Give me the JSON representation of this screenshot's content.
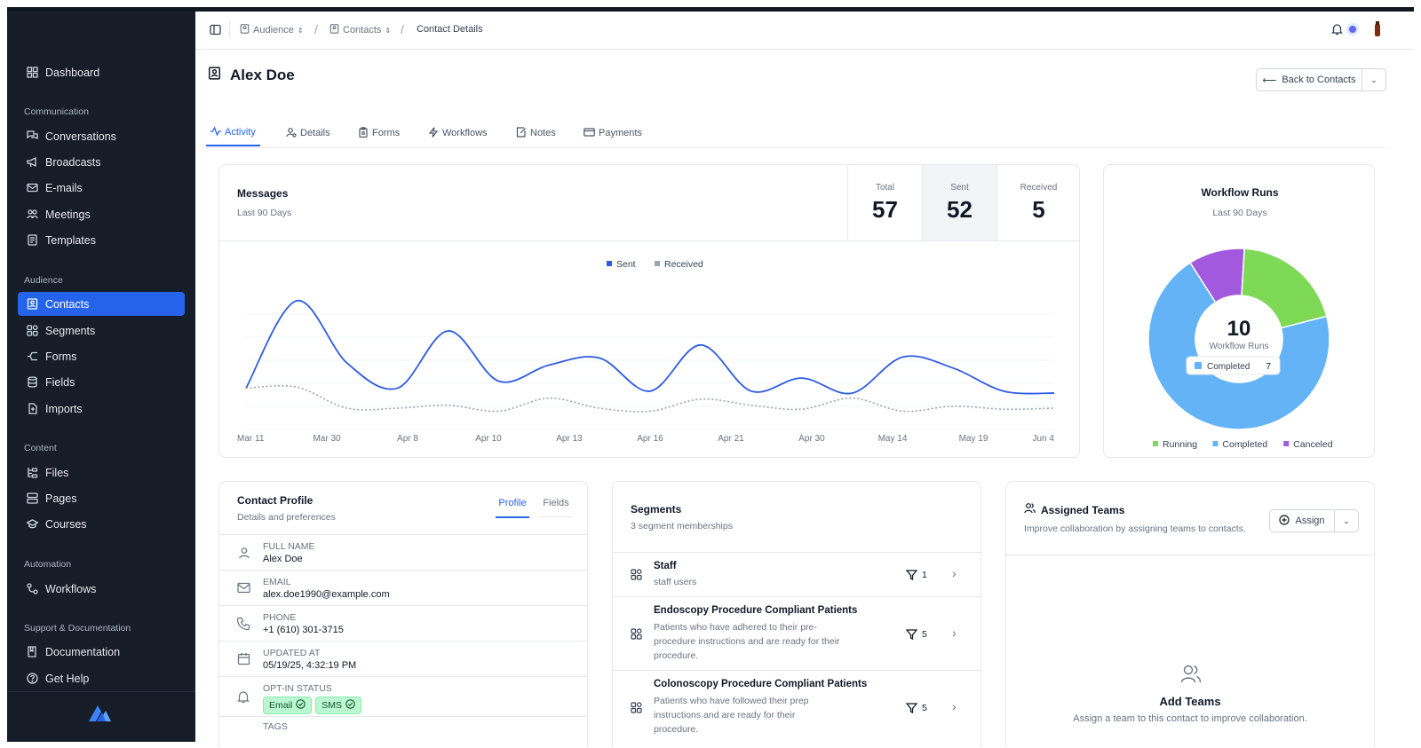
{
  "sidebar": {
    "dashboard": "Dashboard",
    "sections": {
      "communication": "Communication",
      "audience": "Audience",
      "content": "Content",
      "automation": "Automation",
      "support": "Support & Documentation"
    },
    "items": {
      "conversations": "Conversations",
      "broadcasts": "Broadcasts",
      "emails": "E-mails",
      "meetings": "Meetings",
      "templates": "Templates",
      "contacts": "Contacts",
      "segments": "Segments",
      "forms": "Forms",
      "fields": "Fields",
      "imports": "Imports",
      "files": "Files",
      "pages": "Pages",
      "courses": "Courses",
      "workflows": "Workflows",
      "documentation": "Documentation",
      "get_help": "Get Help"
    }
  },
  "breadcrumb": {
    "audience": "Audience",
    "contacts": "Contacts",
    "current": "Contact Details"
  },
  "page": {
    "title": "Alex Doe",
    "back_button": "Back to Contacts"
  },
  "tabs": [
    "Activity",
    "Details",
    "Forms",
    "Workflows",
    "Notes",
    "Payments"
  ],
  "messages": {
    "title": "Messages",
    "subtitle": "Last 90 Days",
    "stats": [
      {
        "label": "Total",
        "value": "57"
      },
      {
        "label": "Sent",
        "value": "52"
      },
      {
        "label": "Received",
        "value": "5"
      }
    ]
  },
  "chart_data": [
    {
      "type": "line",
      "x": [
        "Mar 11",
        "Mar 30",
        "Apr 8",
        "Apr 10",
        "Apr 13",
        "Apr 16",
        "Apr 21",
        "Apr 30",
        "May 14",
        "May 19",
        "Jun 4"
      ],
      "series": [
        {
          "name": "Sent",
          "color": "#2d5be3",
          "values": [
            0.05,
            0.92,
            0.3,
            0.05,
            0.62,
            0.12,
            0.28,
            0.35,
            0.02,
            0.48,
            0.02,
            0.15,
            0.0,
            0.36,
            0.25,
            0.02,
            0.0
          ]
        },
        {
          "name": "Received",
          "color": "#9ca3af",
          "values": [
            0.05,
            0.06,
            -0.15,
            -0.15,
            -0.12,
            -0.18,
            -0.05,
            -0.15,
            -0.18,
            -0.06,
            -0.12,
            -0.16,
            -0.05,
            -0.18,
            -0.13,
            -0.16,
            -0.15
          ]
        }
      ],
      "title": "",
      "xlabel": "",
      "ylabel": "",
      "grid": true,
      "legend": "top-center"
    },
    {
      "type": "pie",
      "title": "Workflow Runs",
      "subtitle": "Last 90 Days",
      "center_value": "10",
      "center_label": "Workflow Runs",
      "tooltip": {
        "label": "Completed",
        "value": "7"
      },
      "slices": [
        {
          "label": "Running",
          "value": 2,
          "color": "#7ed957"
        },
        {
          "label": "Completed",
          "value": 7,
          "color": "#63b3f6"
        },
        {
          "label": "Canceled",
          "value": 1,
          "color": "#a259de"
        }
      ],
      "legend": "bottom"
    }
  ],
  "profile": {
    "title": "Contact Profile",
    "subtitle": "Details and preferences",
    "tabs": [
      "Profile",
      "Fields"
    ],
    "rows": [
      {
        "label": "FULL NAME",
        "value": "Alex Doe"
      },
      {
        "label": "EMAIL",
        "value": "alex.doe1990@example.com"
      },
      {
        "label": "PHONE",
        "value": "+1 (610) 301-3715"
      },
      {
        "label": "UPDATED AT",
        "value": "05/19/25, 4:32:19 PM"
      },
      {
        "label": "OPT-IN STATUS",
        "value": ""
      }
    ],
    "optin": [
      "Email",
      "SMS"
    ],
    "tags_label": "TAGS"
  },
  "segments": {
    "title": "Segments",
    "subtitle": "3 segment memberships",
    "items": [
      {
        "name": "Staff",
        "desc": "staff users",
        "count": "1"
      },
      {
        "name": "Endoscopy Procedure Compliant Patients",
        "desc": "Patients who have adhered to their pre-procedure instructions and are ready for their procedure.",
        "count": "5"
      },
      {
        "name": "Colonoscopy Procedure Compliant Patients",
        "desc": "Patients who have followed their prep instructions and are ready for their procedure.",
        "count": "5"
      }
    ]
  },
  "teams": {
    "title": "Assigned Teams",
    "subtitle": "Improve collaboration by assigning teams to contacts.",
    "assign_button": "Assign",
    "empty_title": "Add Teams",
    "empty_desc": "Assign a team to this contact to improve collaboration."
  }
}
